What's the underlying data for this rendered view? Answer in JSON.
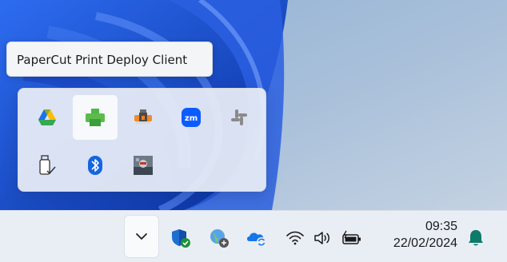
{
  "tooltip": {
    "text": "PaperCut Print Deploy Client"
  },
  "tray_overflow": {
    "icons": [
      {
        "name": "google-drive-icon",
        "selected": false
      },
      {
        "name": "papercut-printer-icon",
        "selected": true
      },
      {
        "name": "print-deploy-agent-icon",
        "selected": false
      },
      {
        "name": "zoom-icon",
        "selected": false,
        "text": "zm"
      },
      {
        "name": "slack-icon",
        "selected": false
      },
      {
        "name": "usb-safely-remove-icon",
        "selected": false
      },
      {
        "name": "bluetooth-icon",
        "selected": false
      },
      {
        "name": "app-thumbnail-icon",
        "selected": false
      }
    ]
  },
  "taskbar": {
    "clock": {
      "time": "09:35",
      "date": "22/02/2024"
    },
    "system_icons": [
      "chevron-up-icon",
      "windows-security-icon",
      "network-globe-icon",
      "onedrive-icon",
      "wifi-icon",
      "volume-icon",
      "battery-icon",
      "notification-bell-icon"
    ]
  },
  "colors": {
    "accent": "#0f6cbd",
    "wallpaper": "#1d57c7",
    "taskbar": "#e9eef5",
    "bell": "#0e7a6b"
  }
}
